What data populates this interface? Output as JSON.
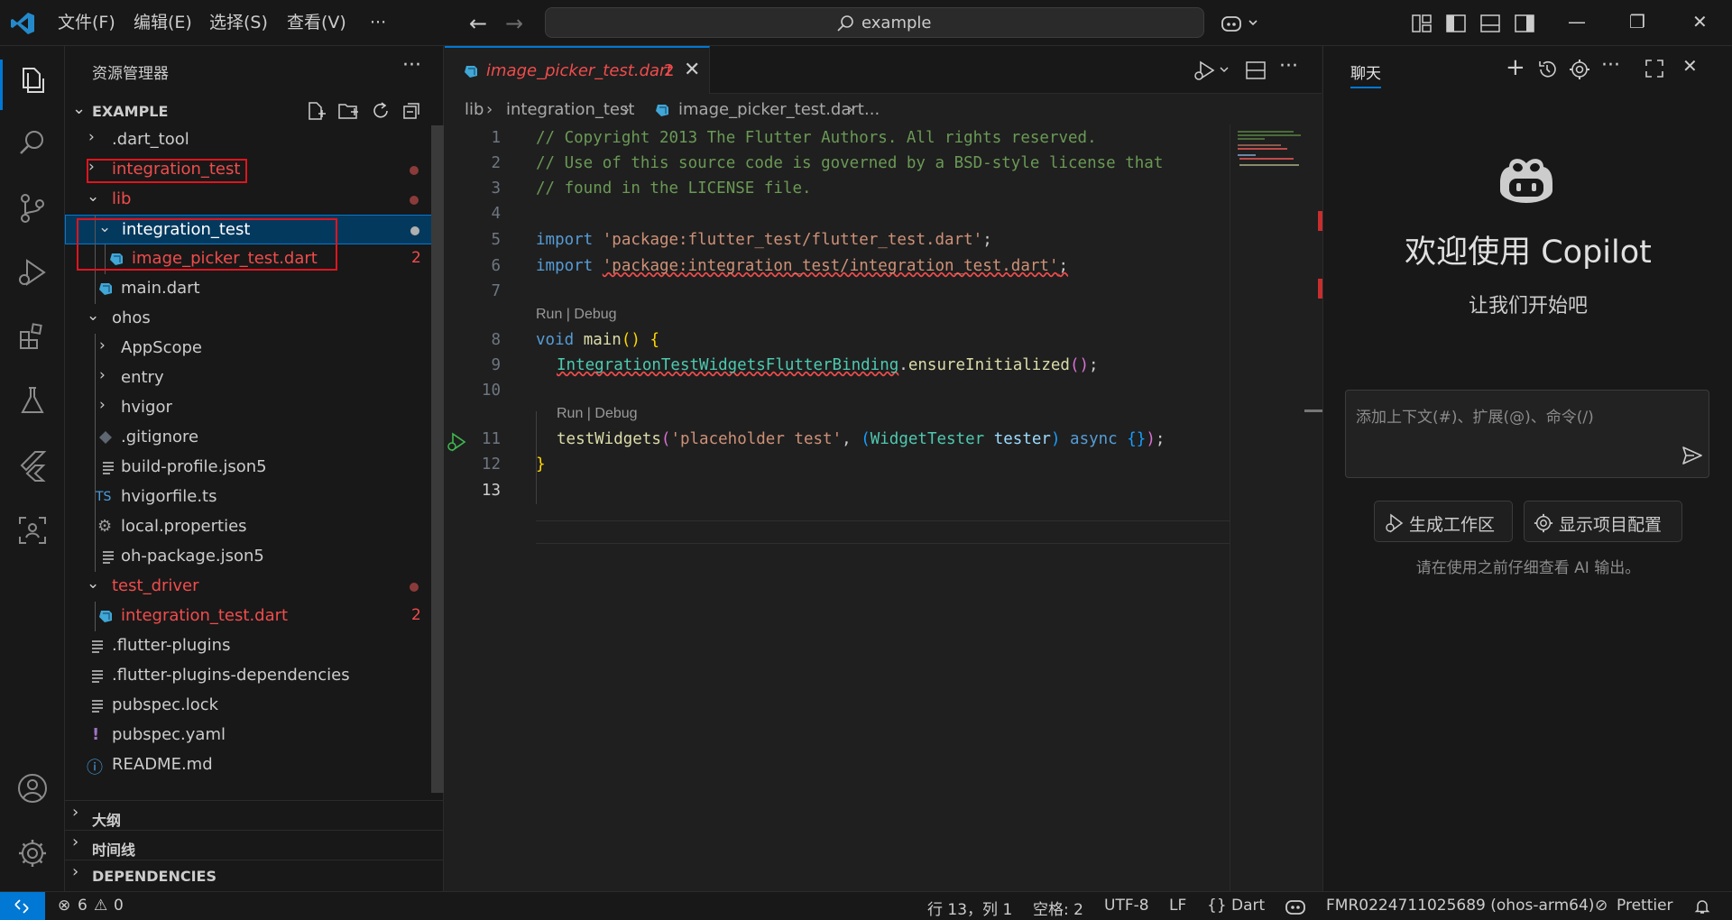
{
  "titlebar": {
    "menus": [
      "文件(F)",
      "编辑(E)",
      "选择(S)",
      "查看(V)"
    ],
    "more": "···",
    "search": "example"
  },
  "colors": {
    "accent": "#0078d4",
    "error": "#f14c4c",
    "selection": "#04395e",
    "annotation_box": "#e0141e"
  },
  "sidebar": {
    "title": "资源管理器",
    "root": "EXAMPLE",
    "tree": [
      {
        "name": ".dart_tool"
      },
      {
        "name": "integration_test"
      },
      {
        "name": "lib"
      },
      {
        "name": "integration_test"
      },
      {
        "name": "image_picker_test.dart",
        "badge": "2"
      },
      {
        "name": "main.dart"
      },
      {
        "name": "ohos"
      },
      {
        "name": "AppScope"
      },
      {
        "name": "entry"
      },
      {
        "name": "hvigor"
      },
      {
        "name": ".gitignore"
      },
      {
        "name": "build-profile.json5"
      },
      {
        "name": "hvigorfile.ts",
        "icon_label": "TS"
      },
      {
        "name": "local.properties"
      },
      {
        "name": "oh-package.json5"
      },
      {
        "name": "test_driver"
      },
      {
        "name": "integration_test.dart",
        "badge": "2"
      },
      {
        "name": ".flutter-plugins"
      },
      {
        "name": ".flutter-plugins-dependencies"
      },
      {
        "name": "pubspec.lock"
      },
      {
        "name": "pubspec.yaml",
        "icon_label": "!"
      },
      {
        "name": "README.md",
        "icon_label": "ⓘ"
      }
    ],
    "sections": [
      "大纲",
      "时间线",
      "DEPENDENCIES"
    ]
  },
  "editor": {
    "tab": {
      "name": "image_picker_test.dart",
      "problems": "2"
    },
    "breadcrumb": [
      "lib",
      "integration_test",
      "image_picker_test.dart",
      "..."
    ],
    "codelens": "Run | Debug",
    "line_numbers": [
      "1",
      "2",
      "3",
      "4",
      "5",
      "6",
      "7",
      "8",
      "9",
      "10",
      "11",
      "12",
      "13"
    ],
    "code": {
      "l1": "// Copyright 2013 The Flutter Authors. All rights reserved.",
      "l2": "// Use of this source code is governed by a BSD-style license that",
      "l3": "// found in the LICENSE file.",
      "kw_import": "import",
      "str5": "'package:flutter_test/flutter_test.dart'",
      "str6": "'package:integration_test/integration_test.dart'",
      "semi": ";",
      "kw_void": "void",
      "fn_main": "main",
      "cls9": "IntegrationTestWidgetsFlutterBinding",
      "fn9": "ensureInitialized",
      "fn11": "testWidgets",
      "str11": "'placeholder test'",
      "cls11": "WidgetTester",
      "var11": "tester",
      "kw_async": "async"
    }
  },
  "chat": {
    "tab": "聊天",
    "welcome": "欢迎使用 Copilot",
    "subtitle": "让我们开始吧",
    "placeholder": "添加上下文(#)、扩展(@)、命令(/)",
    "buttons": [
      "生成工作区",
      "显示项目配置"
    ],
    "note": "请在使用之前仔细查看 AI 输出。"
  },
  "statusbar": {
    "errors": "6",
    "warnings": "0",
    "position": "行 13，列 1",
    "spaces": "空格: 2",
    "encoding": "UTF-8",
    "eol": "LF",
    "language": "{} Dart",
    "device": "FMR0224711025689 (ohos-arm64)",
    "formatter": "Prettier"
  }
}
